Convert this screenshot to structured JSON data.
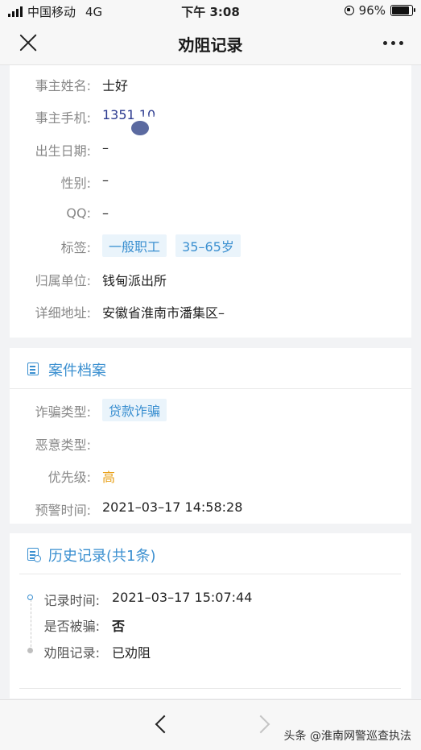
{
  "status_bar": {
    "carrier": "中国移动",
    "network": "4G",
    "time": "下午 3:08",
    "battery": "96%",
    "battery_level": 0.96
  },
  "nav": {
    "title": "劝阻记录"
  },
  "owner_info": [
    {
      "label": "事主姓名:",
      "value": "士好"
    },
    {
      "label": "事主手机:",
      "value": "1351 10"
    },
    {
      "label": "出生日期:",
      "value": "–"
    },
    {
      "label": "性别:",
      "value": "–"
    },
    {
      "label": "QQ:",
      "value": "–"
    },
    {
      "label": "标签:",
      "tags": [
        "一般职工",
        "35–65岁"
      ]
    },
    {
      "label": "归属单位:",
      "value": "钱甸派出所"
    },
    {
      "label": "详细地址:",
      "value": "安徽省淮南市潘集区–"
    }
  ],
  "case_file": {
    "title": "案件档案",
    "rows": [
      {
        "label": "诈骗类型:",
        "tag": "贷款诈骗"
      },
      {
        "label": "恶意类型:",
        "value": ""
      },
      {
        "label": "优先级:",
        "value": "高"
      },
      {
        "label": "预警时间:",
        "value": "2021–03–17 14:58:28"
      }
    ]
  },
  "history": {
    "title": "历史记录(共1条)",
    "rows": [
      {
        "label": "记录时间:",
        "value": "2021–03–17 15:07:44"
      },
      {
        "label": "是否被骗:",
        "value": "否"
      },
      {
        "label": "劝阻记录:",
        "value": "已劝阻"
      }
    ]
  },
  "watermark": "头条 @淮南网警巡查执法",
  "colors": {
    "accent": "#3a8fd0",
    "tag_bg": "#eaf4fb",
    "priority_high": "#e8a017",
    "phone": "#2b3a8f"
  }
}
